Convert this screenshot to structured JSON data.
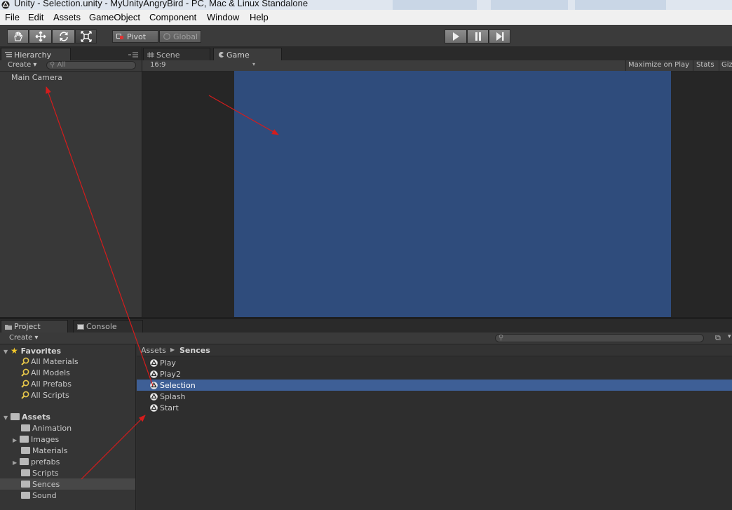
{
  "window": {
    "title": "Unity - Selection.unity - MyUnityAngryBird - PC, Mac & Linux Standalone"
  },
  "menu": [
    "File",
    "Edit",
    "Assets",
    "GameObject",
    "Component",
    "Window",
    "Help"
  ],
  "toolbar": {
    "pivot": "Pivot",
    "global": "Global"
  },
  "hierarchy": {
    "tab": "Hierarchy",
    "create": "Create",
    "search_placeholder": "All",
    "items": [
      "Main Camera"
    ]
  },
  "scene_tab": "Scene",
  "game": {
    "tab": "Game",
    "aspect": "16:9",
    "maximize": "Maximize on Play",
    "stats": "Stats",
    "gizmos": "Giz",
    "view_color": "#2f4c7c"
  },
  "project": {
    "tab": "Project",
    "create": "Create",
    "favorites_label": "Favorites",
    "favorites": [
      "All Materials",
      "All Models",
      "All Prefabs",
      "All Scripts"
    ],
    "assets_label": "Assets",
    "folders": [
      "Animation",
      "Images",
      "Materials",
      "prefabs",
      "Scripts",
      "Sences",
      "Sound"
    ],
    "breadcrumb_root": "Assets",
    "breadcrumb_current": "Sences",
    "files": [
      "Play",
      "Play2",
      "Selection",
      "Splash",
      "Start"
    ],
    "selected_file": "Selection",
    "selected_color": "#3e5f96"
  },
  "console_tab": "Console",
  "annotation_color": "#d51c1c"
}
